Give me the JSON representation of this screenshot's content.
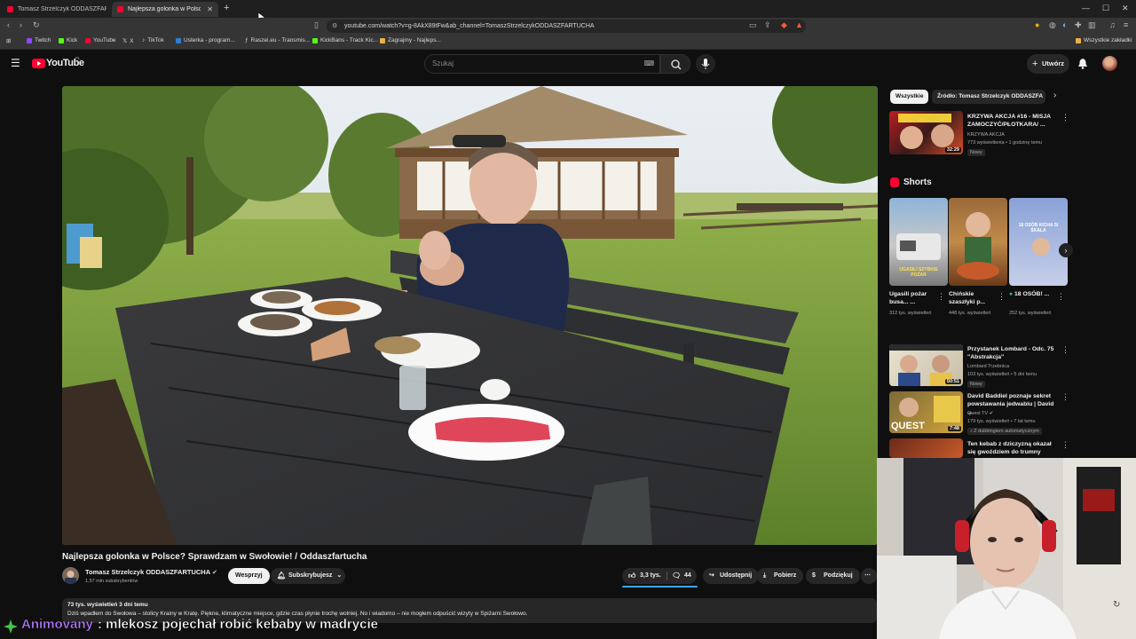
{
  "browser": {
    "tabs": [
      {
        "title": "Tomasz Strzelczyk ODDASZFARTUCHA",
        "active": false
      },
      {
        "title": "Najlepsza golonka w Polsce?",
        "active": true
      }
    ],
    "new_tab_icon": "plus-icon",
    "url": "youtube.com/watch?v=g-8AkX89tFw&ab_channel=TomaszStrzelczykODDASZFARTUCHA",
    "bookmarks": [
      "Twitch",
      "Kick",
      "YouTube",
      "X",
      "TikTok",
      "Usterka - program...",
      "Raszei.eu - Transmis...",
      "KickBans - Track Kic...",
      "Zagrajmy - Najleps..."
    ],
    "all_bookmarks": "Wszystkie zakładki"
  },
  "youtube": {
    "logo": "YouTube",
    "logo_region": "PL",
    "search_placeholder": "Szukaj",
    "create_label": "Utwórz"
  },
  "video": {
    "title": "Najlepsza golonka w Polsce? Sprawdzam w Swołowie! / Oddaszfartucha",
    "channel": "Tomasz Strzelczyk ODDASZFARTUCHA",
    "subscribers": "1,57 mln subskrybentów",
    "support_label": "Wesprzyj",
    "subscribed_label": "Subskrybujesz",
    "likes": "3,3 tys.",
    "comments": "44",
    "share_label": "Udostępnij",
    "download_label": "Pobierz",
    "thanks_label": "Podziękuj",
    "views_date": "73 tys. wyświetleń  3 dni temu",
    "description": "Dziś wpadłem do Swołowa – stolicy Krainy w Kratę. Piękne, klimatyczne miejsce, gdzie czas płynie trochę wolniej. No i wiadomo – nie mogłem odpuścić wizyty w Spiżarni Swołowo."
  },
  "sidebar": {
    "chips": [
      "Wszystkie",
      "Źródło: Tomasz Strzelczyk ODDASZFA"
    ],
    "top_video": {
      "title": "KRZYWA AKCJA #16 - MISJA ZAMOCZYĆ/PŁOTKARA/ ...",
      "channel": "KRZYWA AKCJA",
      "meta": "773 wyświetlenia • 1 godzinę temu",
      "badge": "Nowy",
      "duration": "32:29"
    },
    "shorts_heading": "Shorts",
    "shorts": [
      {
        "title": "Ugasili pożar busa... ...",
        "views": "312 tys. wyświetleń",
        "thumb_text": "UGASILI SZYBKIE POŻAR"
      },
      {
        "title": "Chińskie szaszłyki p...",
        "views": "448 tys. wyświetleń",
        "thumb_text": ""
      },
      {
        "title": "18 OSÓB! ...",
        "views": "252 tys. wyświetleń",
        "thumb_text": "18 OSÓB KICHA SI ŚKALA"
      }
    ],
    "videos": [
      {
        "title": "Przystanek Lombard - Odc. 75 \"Abstrakcja\"",
        "channel": "Lombard Trzebnica",
        "meta": "103 tys. wyświetleń • 5 dni temu",
        "badge": "Nowy",
        "duration": "50:51"
      },
      {
        "title": "David Baddiel poznaje sekret powstawania jedwabiu | David ...",
        "channel": "Quest TV",
        "meta": "179 tys. wyświetleń • 7 lat temu",
        "badge": "Z dubbingiem automatycznym",
        "duration": "7:48",
        "thumb_text": "QUEST"
      },
      {
        "title": "Ten kebab z dziczyzną okazał się gwoździem do trumny",
        "channel": "",
        "meta": "",
        "badge": "",
        "duration": ""
      }
    ]
  },
  "chat": {
    "user": "Animovany",
    "message": ": mlekosz pojechał robić kebaby w madrycie"
  }
}
